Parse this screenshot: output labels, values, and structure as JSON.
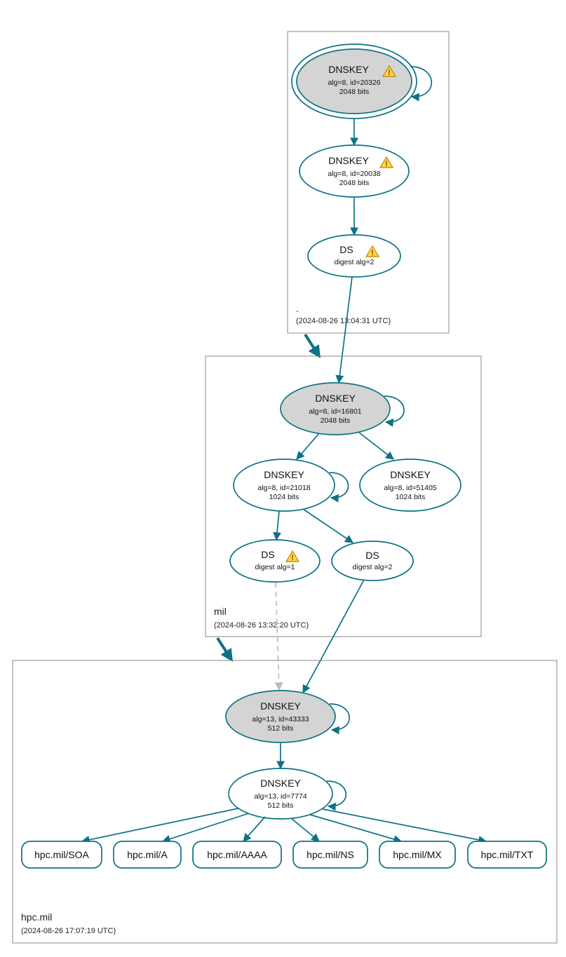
{
  "colors": {
    "border": "#0b7285",
    "zone_border": "#888888",
    "grey_fill": "#d4d4d4",
    "dashed": "#bbbbbb"
  },
  "zones": {
    "root": {
      "label": ".",
      "sublabel": "(2024-08-26 13:04:31 UTC)"
    },
    "mil": {
      "label": "mil",
      "sublabel": "(2024-08-26 13:32:20 UTC)"
    },
    "hpc": {
      "label": "hpc.mil",
      "sublabel": "(2024-08-26 17:07:19 UTC)"
    }
  },
  "nodes": {
    "root_ksk": {
      "title": "DNSKEY",
      "line2": "alg=8, id=20326",
      "line3": "2048 bits",
      "warn": true
    },
    "root_zsk": {
      "title": "DNSKEY",
      "line2": "alg=8, id=20038",
      "line3": "2048 bits",
      "warn": true
    },
    "root_ds": {
      "title": "DS",
      "line2": "digest alg=2",
      "warn": true
    },
    "mil_ksk": {
      "title": "DNSKEY",
      "line2": "alg=8, id=16801",
      "line3": "2048 bits",
      "warn": false
    },
    "mil_zsk1": {
      "title": "DNSKEY",
      "line2": "alg=8, id=21018",
      "line3": "1024 bits",
      "warn": false
    },
    "mil_zsk2": {
      "title": "DNSKEY",
      "line2": "alg=8, id=51405",
      "line3": "1024 bits",
      "warn": false
    },
    "mil_ds1": {
      "title": "DS",
      "line2": "digest alg=1",
      "warn": true
    },
    "mil_ds2": {
      "title": "DS",
      "line2": "digest alg=2",
      "warn": false
    },
    "hpc_ksk": {
      "title": "DNSKEY",
      "line2": "alg=13, id=43333",
      "line3": "512 bits",
      "warn": false
    },
    "hpc_zsk": {
      "title": "DNSKEY",
      "line2": "alg=13, id=7774",
      "line3": "512 bits",
      "warn": false
    }
  },
  "rrsets": {
    "soa": "hpc.mil/SOA",
    "a": "hpc.mil/A",
    "aaaa": "hpc.mil/AAAA",
    "ns": "hpc.mil/NS",
    "mx": "hpc.mil/MX",
    "txt": "hpc.mil/TXT"
  }
}
